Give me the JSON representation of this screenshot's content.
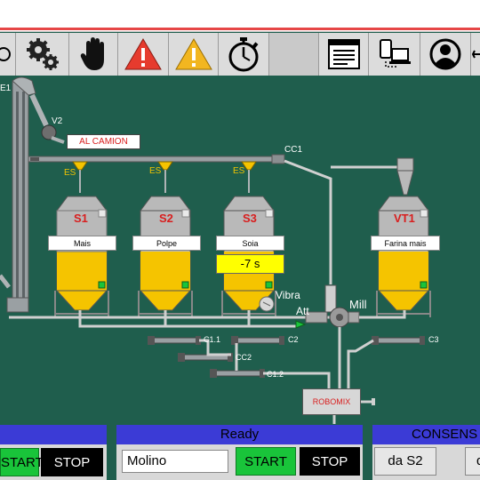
{
  "toolbar": {
    "icons": [
      "settings-icon",
      "manual-hand-icon",
      "alarm-icon",
      "warning-icon",
      "timer-icon",
      "report-icon",
      "network-icon",
      "user-icon"
    ]
  },
  "plant": {
    "labels": {
      "e1": "E1",
      "v2": "V2",
      "truck": "AL CAMION",
      "cc1": "CC1",
      "es1": "ES",
      "es2": "ES",
      "es3": "ES",
      "vibra": "Vibra",
      "att": "Att",
      "mill": "Mill",
      "c1_1": "C1.1",
      "c2": "C2",
      "cc2": "CC2",
      "c1_2": "C1.2",
      "c3": "C3",
      "robomix": "ROBOMIX"
    },
    "silos": [
      {
        "id": "S1",
        "name": "Mais"
      },
      {
        "id": "S2",
        "name": "Polpe"
      },
      {
        "id": "S3",
        "name": "Soia",
        "timer": "-7 s"
      },
      {
        "id": "VT1",
        "name": "Farina mais"
      }
    ],
    "colors": {
      "background": "#1f5e4d",
      "product": "#f5c400",
      "silo": "#b9b9b9",
      "status_ok": "#19c43a"
    }
  },
  "panels": {
    "left": {
      "start": "START",
      "stop": "STOP"
    },
    "middle": {
      "status": "Ready",
      "field_value": "Molino",
      "start": "START",
      "stop": "STOP"
    },
    "right": {
      "title": "CONSENS",
      "source": "da S2",
      "partial": "d"
    }
  }
}
